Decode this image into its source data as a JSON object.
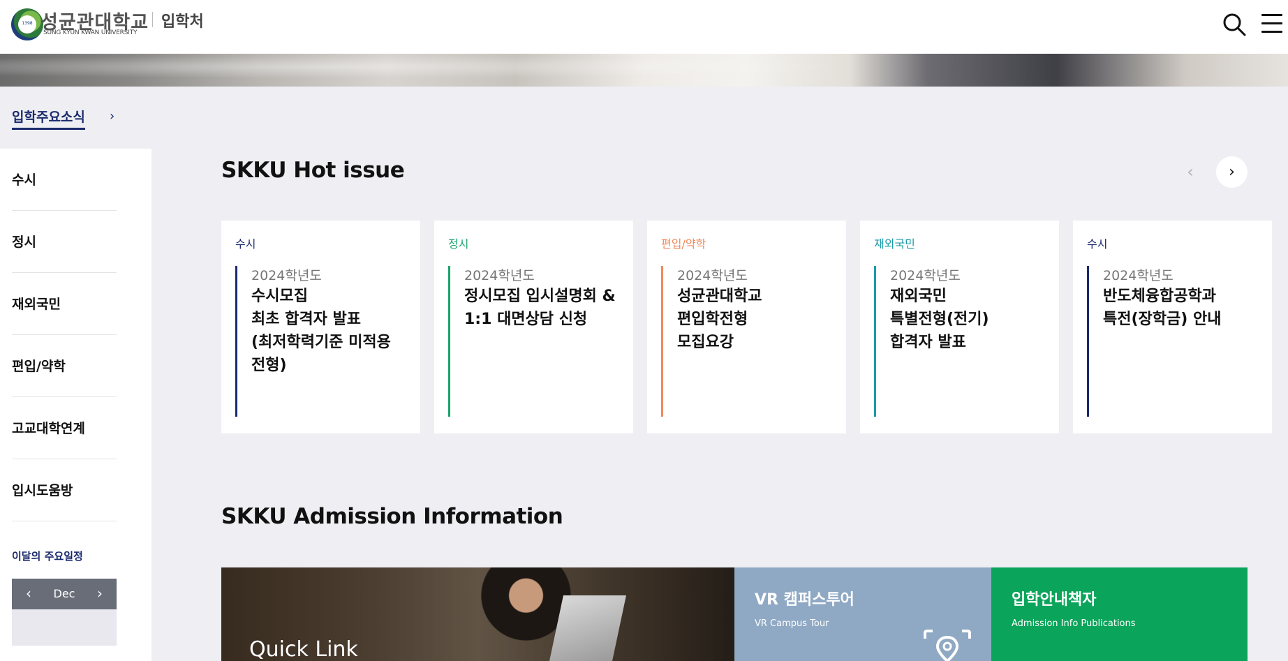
{
  "header": {
    "logo_ko": "성균관대학교",
    "logo_en": "SUNG KYUN KWAN UNIVERSITY",
    "logo_year": "1398",
    "dept": "입학처",
    "icons": [
      "search-icon",
      "menu-icon"
    ]
  },
  "breadcrumb": {
    "label": "입학주요소식",
    "arrow": "›"
  },
  "sidebar": {
    "items": [
      {
        "label": "수시"
      },
      {
        "label": "정시"
      },
      {
        "label": "재외국민"
      },
      {
        "label": "편입/약학"
      },
      {
        "label": "고교대학연계"
      },
      {
        "label": "입시도움방"
      }
    ],
    "schedule_title": "이달의 주요일정",
    "month": "Dec",
    "prev": "‹",
    "next": "›"
  },
  "hot_issue": {
    "title": "SKKU Hot issue",
    "prev": "‹",
    "next": "›",
    "cards": [
      {
        "category": "수시",
        "color": "#1a2a6c",
        "year": "2024학년도",
        "title": "수시모집\n최초 합격자 발표\n(최저학력기준 미적용\n전형)"
      },
      {
        "category": "정시",
        "color": "#1aa36b",
        "year": "2024학년도",
        "title": "정시모집 입시설명회 &\n1:1 대면상담 신청"
      },
      {
        "category": "편입/약학",
        "color": "#f08a5a",
        "year": "2024학년도",
        "title": "성균관대학교\n편입학전형\n모집요강"
      },
      {
        "category": "재외국민",
        "color": "#1a9aa8",
        "year": "2024학년도",
        "title": "재외국민\n특별전형(전기)\n합격자 발표"
      },
      {
        "category": "수시",
        "color": "#1a2a6c",
        "year": "2024학년도",
        "title": "반도체융합공학과\n특전(장학금) 안내"
      }
    ]
  },
  "admission": {
    "title": "SKKU Admission Information",
    "quick_link": "Quick Link",
    "vr": {
      "title": "VR 캠퍼스투어",
      "subtitle": "VR Campus Tour",
      "color": "#8fa9c4"
    },
    "book": {
      "title": "입학안내책자",
      "subtitle": "Admission Info Publications",
      "color": "#0aa45a"
    }
  }
}
